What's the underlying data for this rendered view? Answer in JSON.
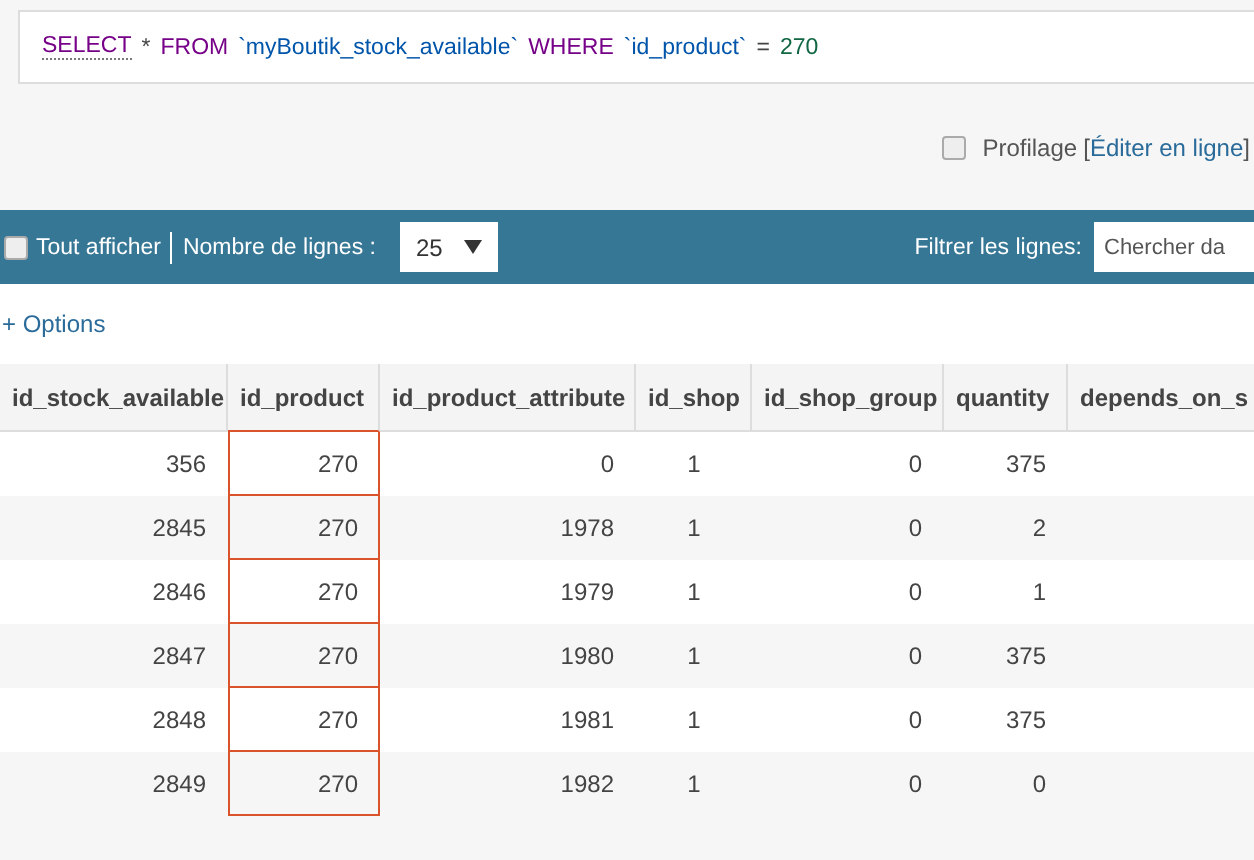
{
  "query": {
    "tokens": [
      {
        "text": "SELECT",
        "kind": "keyword"
      },
      {
        "text": "*",
        "kind": "operator"
      },
      {
        "text": "FROM",
        "kind": "keyword"
      },
      {
        "text": "`myBoutik_stock_available`",
        "kind": "identifier"
      },
      {
        "text": "WHERE",
        "kind": "keyword"
      },
      {
        "text": "`id_product`",
        "kind": "identifier"
      },
      {
        "text": "=",
        "kind": "operator"
      },
      {
        "text": "270",
        "kind": "number"
      }
    ]
  },
  "profiling": {
    "checked": false,
    "label": "Profilage",
    "edit_link": "Éditer en ligne",
    "bracket_open": "[",
    "bracket_close": "]"
  },
  "toolbar": {
    "show_all": {
      "label": "Tout afficher",
      "checked": false
    },
    "rows_label": "Nombre de lignes :",
    "rows_value": "25",
    "filter_label": "Filtrer les lignes:",
    "filter_placeholder": "Chercher da"
  },
  "options_link": "+ Options",
  "table": {
    "columns": [
      {
        "label": "id_stock_available",
        "highlighted": false
      },
      {
        "label": "id_product",
        "highlighted": true
      },
      {
        "label": "id_product_attribute",
        "highlighted": false
      },
      {
        "label": "id_shop",
        "highlighted": false
      },
      {
        "label": "id_shop_group",
        "highlighted": false
      },
      {
        "label": "quantity",
        "highlighted": false
      },
      {
        "label": "depends_on_s",
        "highlighted": false
      }
    ],
    "rows": [
      [
        "356",
        "270",
        "0",
        "1",
        "0",
        "375"
      ],
      [
        "2845",
        "270",
        "1978",
        "1",
        "0",
        "2"
      ],
      [
        "2846",
        "270",
        "1979",
        "1",
        "0",
        "1"
      ],
      [
        "2847",
        "270",
        "1980",
        "1",
        "0",
        "375"
      ],
      [
        "2848",
        "270",
        "1981",
        "1",
        "0",
        "375"
      ],
      [
        "2849",
        "270",
        "1982",
        "1",
        "0",
        "0"
      ]
    ]
  }
}
